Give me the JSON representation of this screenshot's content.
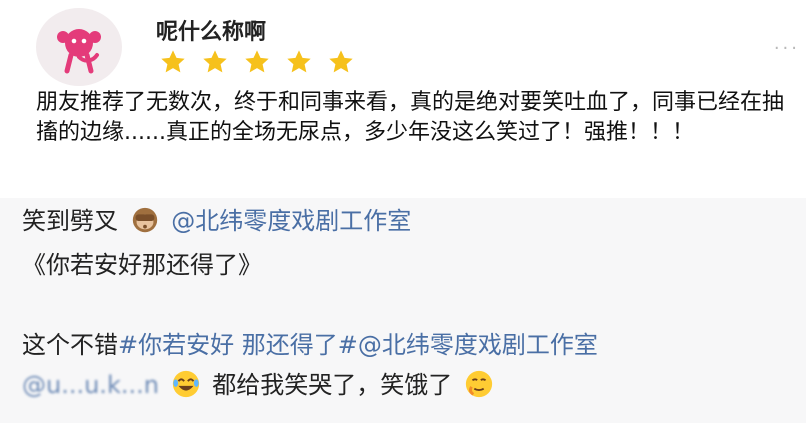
{
  "review": {
    "username": "呢什么称啊",
    "rating": 5,
    "stars_color": "#f6c11c",
    "icons": {
      "avatar": "monkey-avatar-icon",
      "more": "more-dots-icon"
    },
    "text": "朋友推荐了无数次，终于和同事来看，真的是绝对要笑吐血了，同事已经在抽搐的边缘......真正的全场无尿点，多少年没这么笑过了！强推！！！"
  },
  "comments": [
    {
      "prefix": "笑到劈叉",
      "emoji": "see-no-evil-monkey-icon",
      "mention": "@北纬零度戏剧工作室",
      "line2": "《你若安好那还得了》"
    },
    {
      "prefix": "这个不错",
      "tag": "#你若安好 那还得了#",
      "mention": "@北纬零度戏剧工作室",
      "blurred_mention": "@u...u.k...n",
      "emoji1": "laughing-crying-icon",
      "middle": "都给我笑哭了，笑饿了",
      "emoji2": "drooling-face-icon"
    }
  ],
  "colors": {
    "mention": "#4a6fa5",
    "comment_bg": "#f7f7f8"
  }
}
